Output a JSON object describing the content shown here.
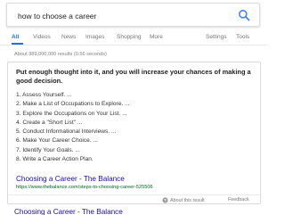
{
  "search": {
    "query": "how to choose a career",
    "icon": "search-icon",
    "accent_color": "#4285f4"
  },
  "tabs": [
    {
      "label": "All"
    },
    {
      "label": "Videos"
    },
    {
      "label": "News"
    },
    {
      "label": "Images"
    },
    {
      "label": "Shopping"
    },
    {
      "label": "More"
    },
    {
      "label": "Settings"
    },
    {
      "label": "Tools"
    }
  ],
  "result_stats": "About 389,000,000 results (0.56 seconds)",
  "snippet": {
    "heading": "Put enough thought into it, and you will increase your chances of making a good decision.",
    "steps": [
      "1. Assess Yourself. ...",
      "2. Make a List of Occupations to Explore. ...",
      "3. Explore the Occupations on Your List. ...",
      "4. Create a \"Short List\" ...",
      "5. Conduct Informational Interviews. ...",
      "6. Make Your Career Choice. ...",
      "7. Identify Your Goals. ...",
      "8. Write a Career Action Plan."
    ],
    "result_title": "Choosing a Career - The Balance",
    "result_url": "https://www.thebalance.com/steps-to-choosing-career-525506",
    "footer": {
      "about_label": "About this result",
      "feedback_label": "Feedback"
    }
  },
  "next_result": {
    "title": "Choosing a Career - The Balance"
  },
  "colors": {
    "link": "#1a0dab",
    "url": "#006621",
    "active_tab": "#1a73e8"
  }
}
